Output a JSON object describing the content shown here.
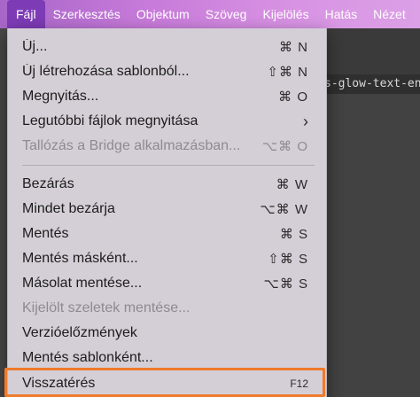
{
  "menubar": {
    "items": [
      {
        "label": "Fájl",
        "active": true
      },
      {
        "label": "Szerkesztés"
      },
      {
        "label": "Objektum"
      },
      {
        "label": "Szöveg"
      },
      {
        "label": "Kijelölés"
      },
      {
        "label": "Hatás"
      },
      {
        "label": "Nézet"
      }
    ]
  },
  "background": {
    "doc_tab_label": "s-glow-text-en"
  },
  "file_menu": {
    "items": [
      {
        "label": "Új...",
        "shortcut": "⌘ N"
      },
      {
        "label": "Új létrehozása sablonból...",
        "shortcut": "⇧⌘ N"
      },
      {
        "label": "Megnyitás...",
        "shortcut": "⌘ O"
      },
      {
        "label": "Legutóbbi fájlok megnyitása",
        "submenu_icon": "chevron-right-icon"
      },
      {
        "label": "Tallózás a Bridge alkalmazásban...",
        "shortcut": "⌥⌘ O",
        "disabled": true
      },
      {
        "label": "Bezárás",
        "shortcut": "⌘ W"
      },
      {
        "label": "Mindet bezárja",
        "shortcut": "⌥⌘ W"
      },
      {
        "label": "Mentés",
        "shortcut": "⌘ S"
      },
      {
        "label": "Mentés másként...",
        "shortcut": "⇧⌘ S"
      },
      {
        "label": "Másolat mentése...",
        "shortcut": "⌥⌘ S"
      },
      {
        "label": "Kijelölt szeletek mentése...",
        "disabled": true
      },
      {
        "label": "Verzióelőzmények"
      },
      {
        "label": "Mentés sablonként..."
      },
      {
        "label": "Visszatérés",
        "shortcut": "F12",
        "highlighted": true
      }
    ],
    "chevron_glyph": "›"
  },
  "colors": {
    "menubar_active": "#7d3bb5",
    "menu_bg": "#d4cfd7",
    "highlight_border": "#f07b2a"
  }
}
